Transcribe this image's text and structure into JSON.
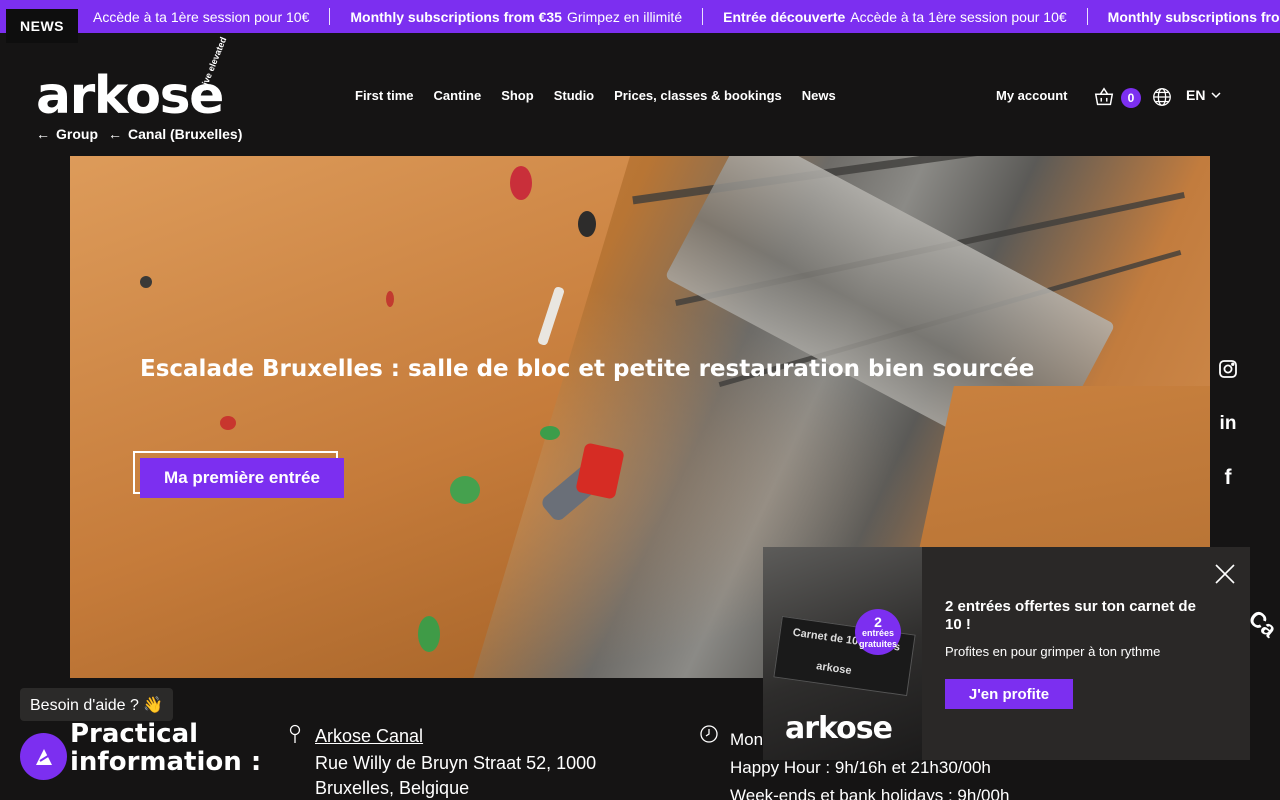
{
  "ticker": {
    "badge": "NEWS",
    "items": [
      {
        "bold": "",
        "text": "Accède à ta 1ère session pour 10€"
      },
      {
        "bold": "Monthly subscriptions from €35",
        "text": "Grimpez en illimité"
      },
      {
        "bold": "Entrée découverte",
        "text": "Accède à ta 1ère session pour 10€"
      },
      {
        "bold": "Monthly subscriptions from",
        "text": ""
      }
    ]
  },
  "header": {
    "logo": "arkose",
    "logo_tagline": "Live elevated",
    "breadcrumbs": [
      "Group",
      "Canal (Bruxelles)"
    ],
    "nav": [
      "First time",
      "Cantine",
      "Shop",
      "Studio",
      "Prices, classes & bookings",
      "News"
    ],
    "account": "My account",
    "cart_count": "0",
    "language": "EN",
    "icons": {
      "cart": "basket-icon",
      "globe": "globe-icon",
      "chevron": "chevron-down-icon"
    }
  },
  "hero": {
    "title": "Escalade Bruxelles : salle de bloc et petite restauration bien sourcée",
    "cta": "Ma première entrée"
  },
  "social": [
    "instagram-icon",
    "linkedin-icon",
    "facebook-icon"
  ],
  "practical": {
    "title": "Practical information :",
    "venue": "Arkose Canal",
    "address": "Rue Willy de Bruyn Straat 52, 1000 Bruxelles, Belgique",
    "hours": [
      "Mon",
      "Happy Hour : 9h/16h et 21h30/00h",
      "Week-ends et bank holidays : 9h/00h"
    ]
  },
  "help": {
    "label": "Besoin d'aide ? 👋"
  },
  "popup": {
    "title": "2 entrées offertes sur ton carnet de 10 !",
    "text": "Profites en pour grimper à ton rythme",
    "button": "J'en profite",
    "ticket_text": "Carnet de 10 entrées",
    "ticket_brand": "arkose",
    "badge_number": "2",
    "badge_text": "entrées gratuites",
    "brand": "arkose"
  },
  "side_text": "Ca",
  "colors": {
    "accent": "#7c2ff0",
    "background": "#151414"
  }
}
